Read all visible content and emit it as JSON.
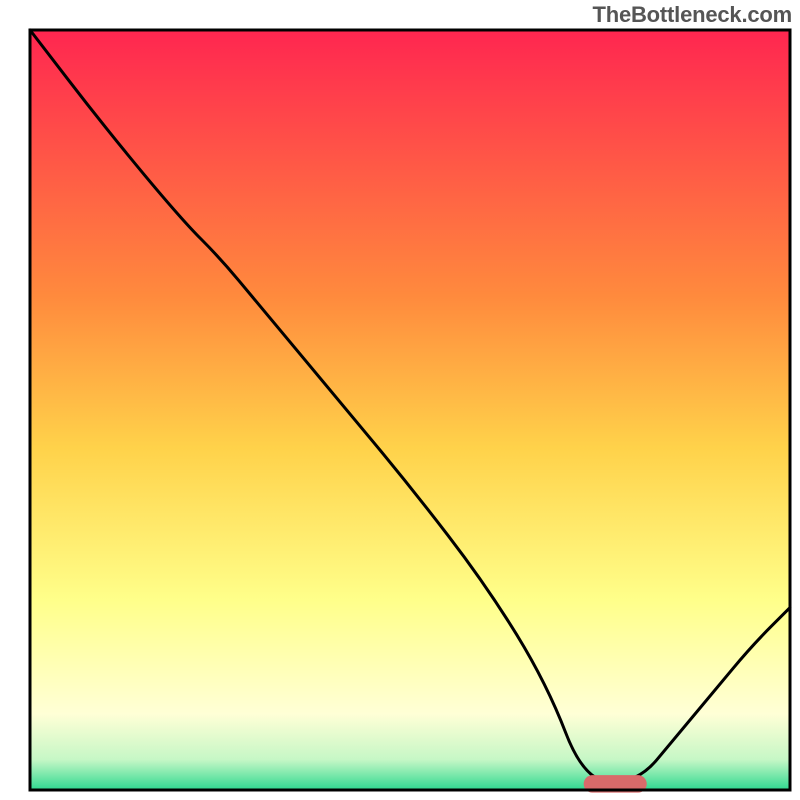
{
  "watermark": "TheBottleneck.com",
  "chart_data": {
    "type": "line",
    "title": "",
    "xlabel": "",
    "ylabel": "",
    "xlim": [
      0,
      100
    ],
    "ylim": [
      0,
      100
    ],
    "background_gradient": {
      "stops": [
        {
          "offset": 0,
          "color": "#ff2650"
        },
        {
          "offset": 35,
          "color": "#ff8a3d"
        },
        {
          "offset": 55,
          "color": "#ffd24a"
        },
        {
          "offset": 75,
          "color": "#ffff8a"
        },
        {
          "offset": 90,
          "color": "#ffffd6"
        },
        {
          "offset": 96,
          "color": "#c6f7c6"
        },
        {
          "offset": 100,
          "color": "#2fd890"
        }
      ]
    },
    "curve": {
      "description": "Bottleneck curve: high on the left, descends with a knee near x≈25, reaches 0 at x≈73–80, rises again to ≈24 at x=100.",
      "x": [
        0,
        10,
        20,
        25,
        30,
        40,
        50,
        60,
        68,
        73,
        80,
        85,
        90,
        95,
        100
      ],
      "y": [
        100,
        87,
        75,
        70,
        64,
        52,
        40,
        27,
        14,
        1,
        1,
        7,
        13,
        19,
        24
      ]
    },
    "marker": {
      "x_start": 74,
      "x_end": 80,
      "y": 0.8,
      "color": "#d86a6a",
      "thickness": 2.3
    },
    "frame_color": "#000000"
  }
}
